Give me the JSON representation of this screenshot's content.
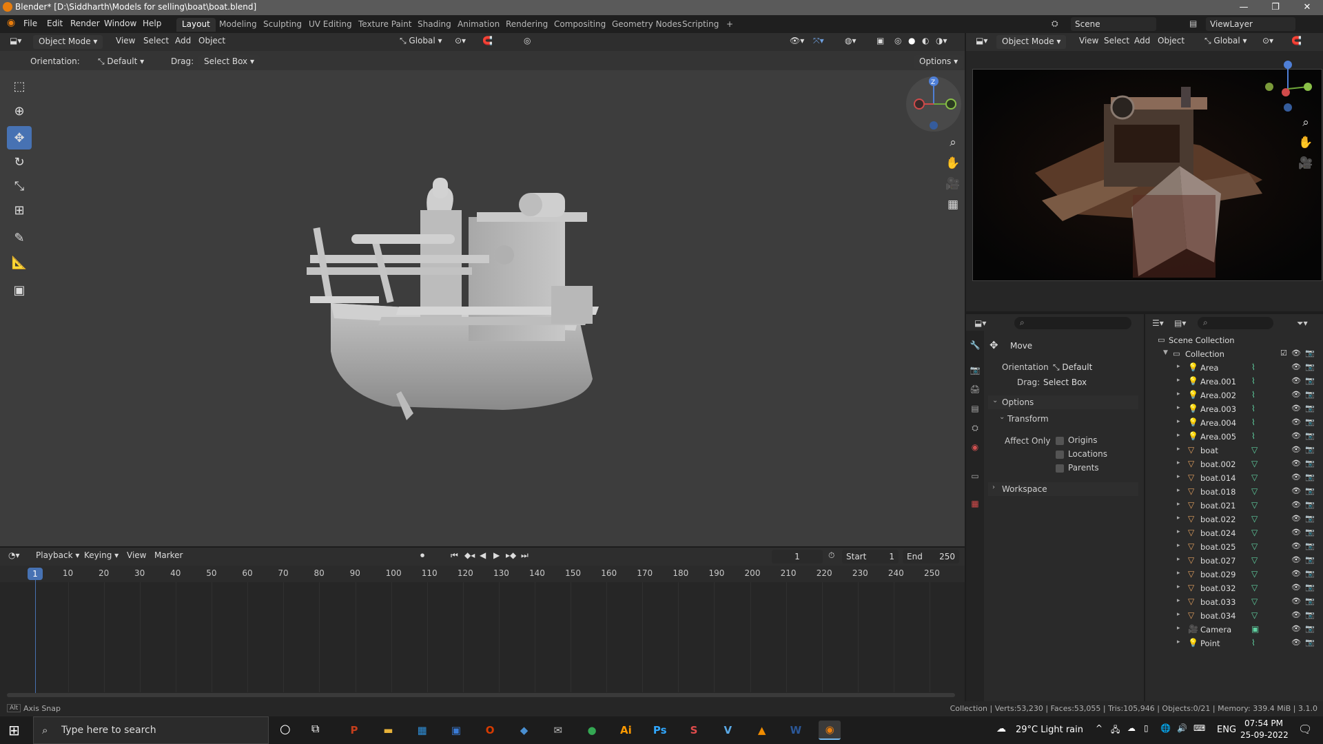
{
  "window": {
    "title": "Blender* [D:\\Siddharth\\Models for selling\\boat\\boat.blend]",
    "minimize": "—",
    "maximize": "❐",
    "close": "✕"
  },
  "menus": [
    "File",
    "Edit",
    "Render",
    "Window",
    "Help"
  ],
  "workspaces": [
    "Layout",
    "Modeling",
    "Sculpting",
    "UV Editing",
    "Texture Paint",
    "Shading",
    "Animation",
    "Rendering",
    "Compositing",
    "Geometry Nodes",
    "Scripting"
  ],
  "add_workspace": "+",
  "scene": {
    "name": "Scene",
    "view_layer": "ViewLayer"
  },
  "viewport": {
    "mode": "Object Mode",
    "menus": [
      "View",
      "Select",
      "Add",
      "Object"
    ],
    "transform_orientation": "Global",
    "orientation_label": "Orientation:",
    "orientation_value": "Default",
    "drag_label": "Drag:",
    "drag_value": "Select Box",
    "options": "Options",
    "gizmo": {
      "x": "X",
      "y": "Y",
      "z": "Z"
    }
  },
  "tools": [
    {
      "name": "select-box-tool",
      "glyph": "⬚"
    },
    {
      "name": "cursor-tool",
      "glyph": "⊕"
    },
    {
      "name": "move-tool",
      "glyph": "✥"
    },
    {
      "name": "rotate-tool",
      "glyph": "↻"
    },
    {
      "name": "scale-tool",
      "glyph": "⤡"
    },
    {
      "name": "transform-tool",
      "glyph": "⊞"
    },
    {
      "name": "annotate-tool",
      "glyph": "✎"
    },
    {
      "name": "measure-tool",
      "glyph": "📐"
    },
    {
      "name": "add-cube-tool",
      "glyph": "▣"
    }
  ],
  "preview": {
    "mode": "Object Mode",
    "menus": [
      "View",
      "Select",
      "Add",
      "Object"
    ],
    "transform_orientation": "Global"
  },
  "properties": {
    "tool_name": "Move",
    "orientation_label": "Orientation",
    "orientation_value": "Default",
    "drag_label": "Drag:",
    "drag_value": "Select Box",
    "options_panel": "Options",
    "transform_panel": "Transform",
    "affect_only": "Affect Only",
    "checkboxes": [
      "Origins",
      "Locations",
      "Parents"
    ],
    "workspace_panel": "Workspace"
  },
  "outliner": {
    "scene_collection": "Scene Collection",
    "collection": "Collection",
    "items": [
      {
        "name": "Area",
        "type": "light"
      },
      {
        "name": "Area.001",
        "type": "light"
      },
      {
        "name": "Area.002",
        "type": "light"
      },
      {
        "name": "Area.003",
        "type": "light"
      },
      {
        "name": "Area.004",
        "type": "light"
      },
      {
        "name": "Area.005",
        "type": "light"
      },
      {
        "name": "boat",
        "type": "mesh"
      },
      {
        "name": "boat.002",
        "type": "mesh"
      },
      {
        "name": "boat.014",
        "type": "mesh"
      },
      {
        "name": "boat.018",
        "type": "mesh"
      },
      {
        "name": "boat.021",
        "type": "mesh"
      },
      {
        "name": "boat.022",
        "type": "mesh"
      },
      {
        "name": "boat.024",
        "type": "mesh"
      },
      {
        "name": "boat.025",
        "type": "mesh"
      },
      {
        "name": "boat.027",
        "type": "mesh"
      },
      {
        "name": "boat.029",
        "type": "mesh"
      },
      {
        "name": "boat.032",
        "type": "mesh"
      },
      {
        "name": "boat.033",
        "type": "mesh"
      },
      {
        "name": "boat.034",
        "type": "mesh"
      },
      {
        "name": "Camera",
        "type": "camera"
      },
      {
        "name": "Point",
        "type": "light"
      }
    ]
  },
  "timeline": {
    "menus": [
      "Playback",
      "Keying",
      "View",
      "Marker"
    ],
    "current_frame": "1",
    "start_label": "Start",
    "start": "1",
    "end_label": "End",
    "end": "250",
    "ticks": [
      "1",
      "10",
      "20",
      "30",
      "40",
      "50",
      "60",
      "70",
      "80",
      "90",
      "100",
      "110",
      "120",
      "130",
      "140",
      "150",
      "160",
      "170",
      "180",
      "190",
      "200",
      "210",
      "220",
      "230",
      "240",
      "250"
    ]
  },
  "status": {
    "left": "Axis Snap",
    "right": "Collection | Verts:53,230 | Faces:53,055 | Tris:105,946 | Objects:0/21 | Memory: 339.4 MiB | 3.1.0"
  },
  "taskbar": {
    "search_placeholder": "Type here to search",
    "weather": "29°C  Light rain",
    "language": "ENG",
    "time": "07:54 PM",
    "date": "25-09-2022",
    "apps": [
      {
        "name": "powerpoint",
        "glyph": "P",
        "color": "#c43e1c"
      },
      {
        "name": "file-explorer",
        "glyph": "▬",
        "color": "#e8b339"
      },
      {
        "name": "photos",
        "glyph": "▦",
        "color": "#2f8fd8"
      },
      {
        "name": "store",
        "glyph": "▣",
        "color": "#3a7bd5"
      },
      {
        "name": "office",
        "glyph": "O",
        "color": "#d83b01"
      },
      {
        "name": "steam",
        "glyph": "◆",
        "color": "#4a8fd0"
      },
      {
        "name": "mail",
        "glyph": "✉",
        "color": "#bbbbbb"
      },
      {
        "name": "chrome",
        "glyph": "●",
        "color": "#34a853"
      },
      {
        "name": "illustrator",
        "glyph": "Ai",
        "color": "#ff9a00"
      },
      {
        "name": "photoshop",
        "glyph": "Ps",
        "color": "#31a8ff"
      },
      {
        "name": "substance",
        "glyph": "S",
        "color": "#e04c4c"
      },
      {
        "name": "vectary",
        "glyph": "V",
        "color": "#5aa9e6"
      },
      {
        "name": "vlc",
        "glyph": "▲",
        "color": "#f08c00"
      },
      {
        "name": "word",
        "glyph": "W",
        "color": "#2b5797"
      },
      {
        "name": "blender",
        "glyph": "◉",
        "color": "#e87d0d"
      }
    ]
  },
  "colors": {
    "accent": "#4772b3",
    "blender_orange": "#e87d0d"
  }
}
